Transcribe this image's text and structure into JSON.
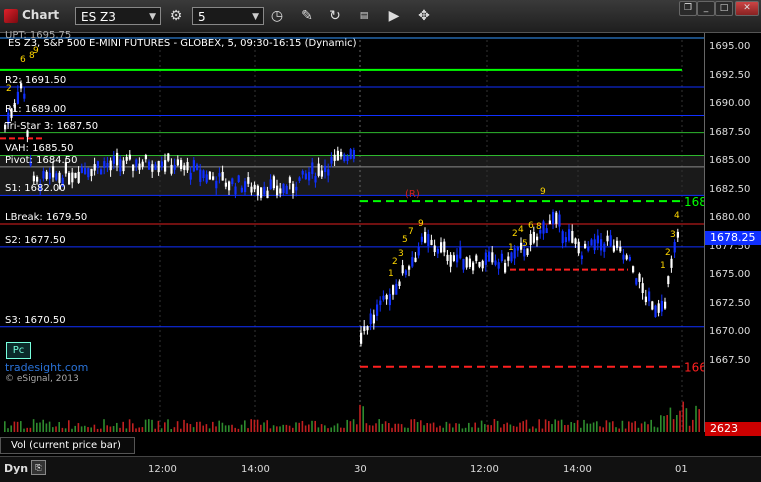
{
  "window": {
    "title": "Chart",
    "symbol": "ES Z3",
    "interval": "5",
    "buttons": [
      "settings-gear",
      "history-clock",
      "draw-pencil",
      "refresh",
      "go-quote",
      "play",
      "cursor-crosshair"
    ],
    "win_controls": [
      "restore",
      "minimize",
      "maximize",
      "close"
    ]
  },
  "chart": {
    "header": "ES Z3, S&P 500 E-MINI FUTURES - GLOBEX, 5, 09:30-16:15 (Dynamic)",
    "header_top": "UPT: 1695.75",
    "levels": [
      {
        "label": "R2: 1691.50",
        "price": 1691.5,
        "color": "#1030ff"
      },
      {
        "label": "R1: 1689.00",
        "price": 1689.0,
        "color": "#1030ff"
      },
      {
        "label": "Tri-Star 3: 1687.50",
        "price": 1687.5,
        "color": "#2eb82e"
      },
      {
        "label": "VAH: 1685.50",
        "price": 1685.5,
        "color": "#2eb82e"
      },
      {
        "label": "Pivot: 1684.50",
        "price": 1684.5,
        "color": "#8a8a8a"
      },
      {
        "label": "S1: 1682.00",
        "price": 1682.0,
        "color": "#1030ff"
      },
      {
        "label": "LBreak: 1679.50",
        "price": 1679.5,
        "color": "#e02020"
      },
      {
        "label": "S2: 1677.50",
        "price": 1677.5,
        "color": "#1030ff"
      },
      {
        "label": "S3: 1670.50",
        "price": 1670.5,
        "color": "#1030ff"
      }
    ],
    "target_labels": [
      "168",
      "166"
    ],
    "r_marker": "(R)",
    "pc_button": "Pc",
    "watermark": "tradesight.com",
    "copyright": "© eSignal, 2013",
    "price_axis": {
      "ticks": [
        "1695.00",
        "1692.50",
        "1690.00",
        "1687.50",
        "1685.00",
        "1682.50",
        "1680.00",
        "1677.50",
        "1675.00",
        "1672.50",
        "1670.00",
        "1667.50"
      ],
      "last_price": "1678.25",
      "last_volume": "2623"
    },
    "time_axis": [
      "12:00",
      "14:00",
      "30",
      "12:00",
      "14:00",
      "01"
    ],
    "volume_label": "Vol (current price bar)",
    "bottom_left": "Dyn",
    "bottom_btn": "⎘",
    "colors": {
      "up": "#ffffff",
      "down": "#1030ff",
      "green_level": "#00ff00",
      "red_level": "#ff2020",
      "count_numbers": "#ffd700"
    }
  },
  "chart_data": {
    "type": "candlestick",
    "title": "ES Z3, S&P 500 E-MINI FUTURES - GLOBEX, 5, 09:30-16:15 (Dynamic)",
    "ylim": [
      1665.5,
      1697.5
    ],
    "day1_close_region": [
      1676,
      1686
    ],
    "day2_range": [
      1669.5,
      1682
    ],
    "last": 1678.25,
    "volume_last": 2623
  }
}
